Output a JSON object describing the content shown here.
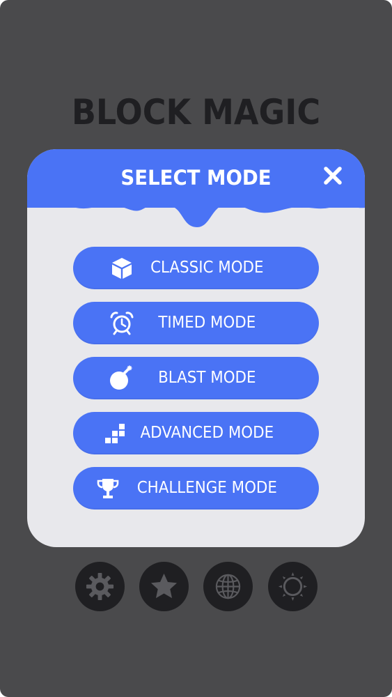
{
  "game": {
    "title": "BLOCK MAGIC"
  },
  "dialog": {
    "title": "SELECT MODE",
    "close_icon": "close-icon"
  },
  "modes": [
    {
      "label": "CLASSIC MODE",
      "icon": "cube-icon"
    },
    {
      "label": "TIMED MODE",
      "icon": "alarm-clock-icon"
    },
    {
      "label": "BLAST MODE",
      "icon": "bomb-icon"
    },
    {
      "label": "ADVANCED MODE",
      "icon": "blocks-icon"
    },
    {
      "label": "CHALLENGE MODE",
      "icon": "trophy-icon"
    }
  ],
  "bottom_buttons": [
    {
      "icon": "gear-icon"
    },
    {
      "icon": "star-icon"
    },
    {
      "icon": "globe-icon"
    },
    {
      "icon": "sun-icon"
    }
  ],
  "colors": {
    "background": "#4a4a4c",
    "accent": "#4a73f5",
    "panel": "#e8e8ec",
    "dark": "#1f1f22",
    "icon_gray": "#5a5a5e"
  }
}
